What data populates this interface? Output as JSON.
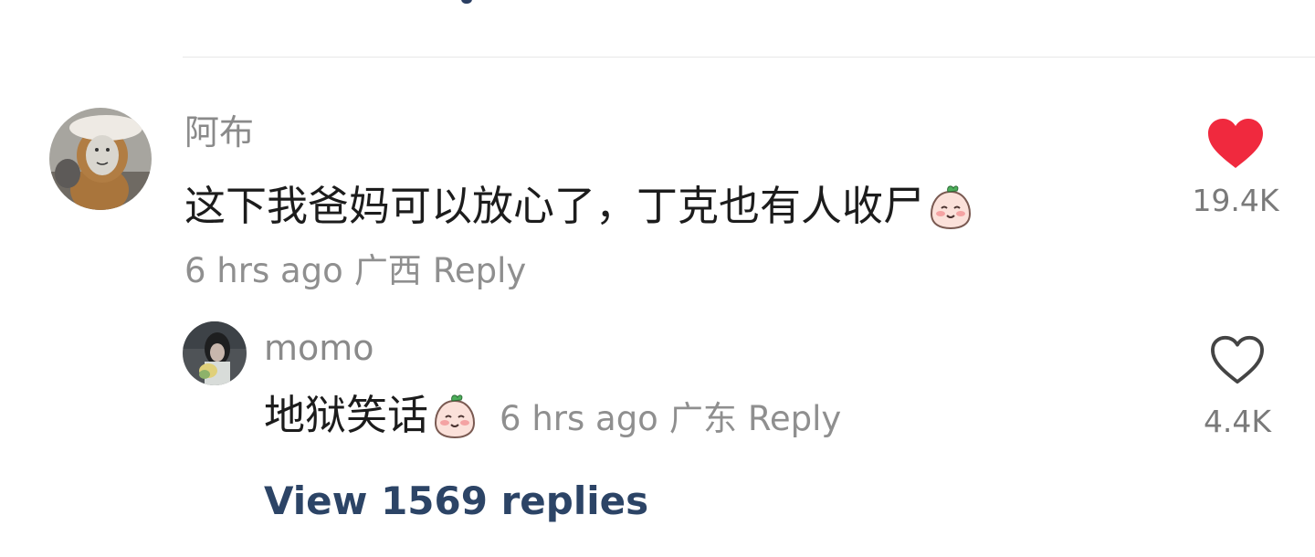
{
  "comment": {
    "username": "阿布",
    "text": "这下我爸妈可以放心了，丁克也有人收尸",
    "emoji": "peach-blush-emoji",
    "time": "6 hrs ago",
    "location": "广西",
    "reply_label": "Reply",
    "likes": "19.4K",
    "liked": true
  },
  "reply": {
    "username": "momo",
    "text": "地狱笑话",
    "emoji": "peach-blush-emoji",
    "time": "6 hrs ago",
    "location": "广东",
    "reply_label": "Reply",
    "likes": "4.4K",
    "liked": false
  },
  "view_replies_label": "View 1569 replies",
  "colors": {
    "like_active": "#f0293e",
    "like_inactive": "#444444",
    "link": "#2c4466",
    "muted": "#8f8f8f"
  }
}
